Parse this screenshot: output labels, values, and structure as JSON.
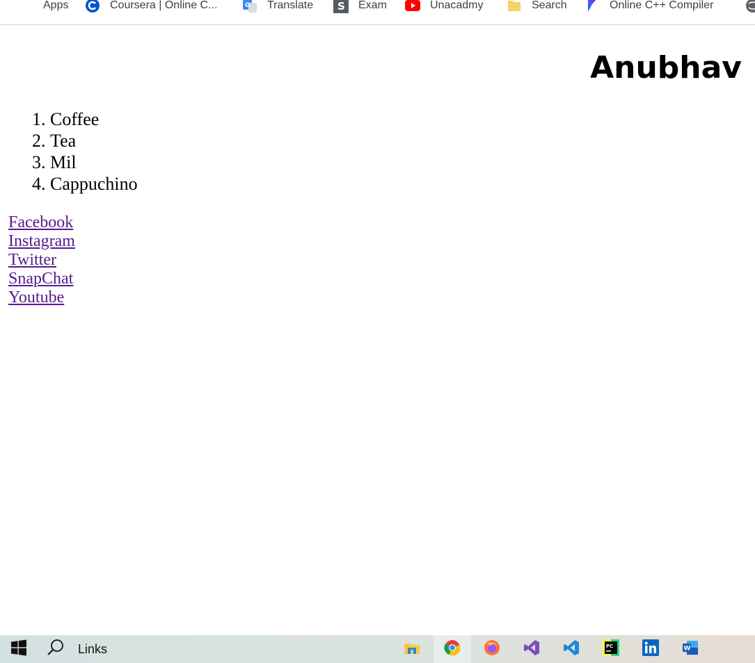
{
  "bookmarks": [
    {
      "label": "Apps",
      "icon": "apps-grid-icon"
    },
    {
      "label": "Coursera | Online C...",
      "icon": "coursera-icon"
    },
    {
      "label": "Translate",
      "icon": "google-translate-icon"
    },
    {
      "label": "Exam",
      "icon": "exam-icon"
    },
    {
      "label": "Unacadmy",
      "icon": "youtube-icon"
    },
    {
      "label": "Search",
      "icon": "folder-icon"
    },
    {
      "label": "Online C++ Compiler",
      "icon": "compiler-icon"
    }
  ],
  "page": {
    "heading": "Anubhav",
    "drinks": [
      "Coffee",
      "Tea",
      "Mil",
      "Cappuchino"
    ],
    "links": [
      "Facebook",
      "Instagram",
      "Twitter",
      "SnapChat",
      "Youtube"
    ]
  },
  "taskbar": {
    "search_label": "Links",
    "apps": [
      "file-explorer-icon",
      "chrome-icon",
      "firefox-icon",
      "visual-studio-icon",
      "vscode-icon",
      "pycharm-icon",
      "linkedin-icon",
      "word-icon"
    ]
  },
  "colors": {
    "link": "#551a8b",
    "taskbar_active": "#e9ecec"
  }
}
